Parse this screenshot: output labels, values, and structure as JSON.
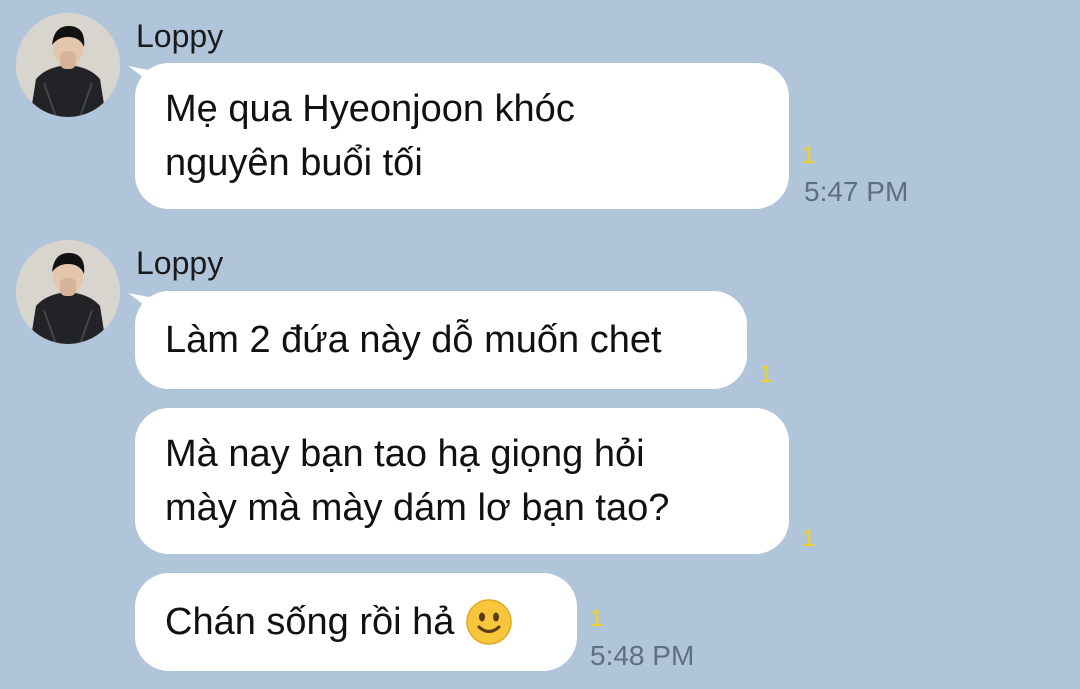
{
  "messages": [
    {
      "sender": "Loppy",
      "text": "Mẹ qua Hyeonjoon khóc\nnguyên buổi tối",
      "read": "1",
      "time": "5:47 PM"
    },
    {
      "sender": "Loppy",
      "text": "Làm 2 đứa này dỗ muốn chet",
      "read": "1"
    },
    {
      "text": "Mà nay bạn tao hạ giọng hỏi\nmày mà mày dám lơ bạn tao?",
      "read": "1"
    },
    {
      "text": "Chán sống rồi hả",
      "emoji": "slightly-smiling-face",
      "read": "1",
      "time": "5:48 PM"
    }
  ],
  "colors": {
    "background": "#b0c5da",
    "bubble": "#ffffff",
    "read_count": "#f2d21b",
    "timestamp": "#5e6f80"
  }
}
